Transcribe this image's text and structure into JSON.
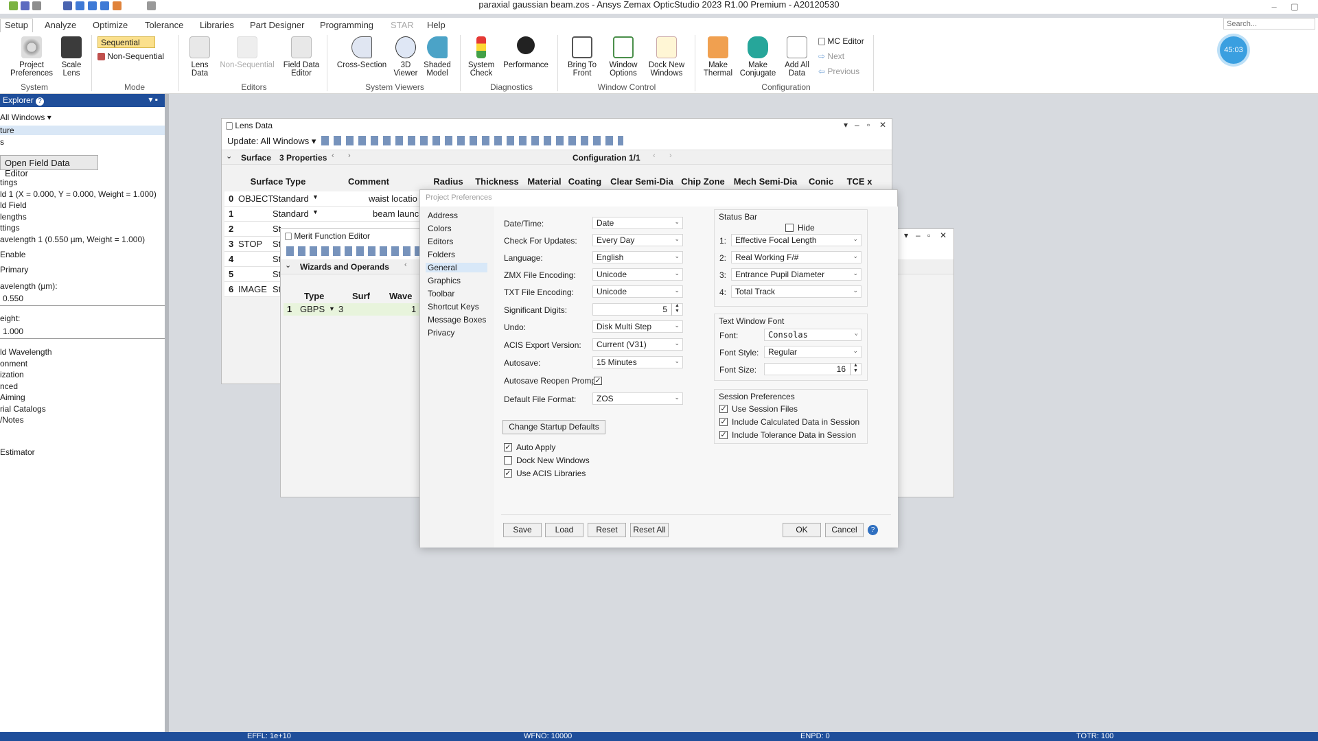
{
  "window": {
    "title": "paraxial gaussian beam.zos - Ansys Zemax OpticStudio 2023 R1.00   Premium - A20120530",
    "search_placeholder": "Search..."
  },
  "menu": {
    "tabs": [
      "Setup",
      "Analyze",
      "Optimize",
      "Tolerance",
      "Libraries",
      "Part Designer",
      "Programming",
      "STAR",
      "Help"
    ]
  },
  "ribbon": {
    "system": {
      "project_preferences": "Project Preferences",
      "scale_lens": "Scale Lens",
      "group": "System"
    },
    "mode": {
      "sequential": "Sequential",
      "non_sequential": "Non-Sequential",
      "group": "Mode"
    },
    "editors": {
      "lens_data": "Lens Data",
      "non_sequential": "Non-Sequential",
      "field_data_editor": "Field Data Editor",
      "group": "Editors"
    },
    "viewers": {
      "cross_section": "Cross-Section",
      "viewer_3d": "3D Viewer",
      "shaded_model": "Shaded Model",
      "group": "System Viewers"
    },
    "diagnostics": {
      "system_check": "System Check",
      "performance": "Performance",
      "group": "Diagnostics"
    },
    "window_control": {
      "bring_to_front": "Bring To Front",
      "window_options": "Window Options",
      "dock_new_windows": "Dock New Windows",
      "group": "Window Control"
    },
    "configuration": {
      "make_thermal": "Make Thermal",
      "make_conjugate": "Make Conjugate",
      "add_all_data": "Add All Data",
      "mc_editor": "MC Editor",
      "next": "Next",
      "previous": "Previous",
      "group": "Configuration"
    },
    "timer": "45:03"
  },
  "explorer": {
    "title": "Explorer",
    "update": "All Windows",
    "items": [
      "ture",
      "s",
      "tings",
      "ld 1 (X = 0.000, Y = 0.000, Weight = 1.000)",
      "ld Field",
      "lengths",
      "ttings",
      "avelength 1 (0.550 µm, Weight = 1.000)",
      "Enable",
      "Primary",
      "avelength (µm):",
      "eight:",
      "ld Wavelength",
      "onment",
      "ization",
      "nced",
      "Aiming",
      "rial Catalogs",
      "/Notes",
      "Estimator"
    ],
    "open_field_button": "Open Field Data Editor",
    "wavelength_value": "0.550",
    "weight_value": "1.000"
  },
  "lens_data": {
    "title": "Lens Data",
    "update": "Update: All Windows",
    "surface_label": "Surface",
    "properties": "3 Properties",
    "configuration": "Configuration 1/1",
    "columns": [
      "Surface Type",
      "Comment",
      "Radius",
      "Thickness",
      "Material",
      "Coating",
      "Clear Semi-Dia",
      "Chip Zone",
      "Mech Semi-Dia",
      "Conic",
      "TCE x"
    ],
    "rows": [
      {
        "num": "0",
        "label": "OBJECT",
        "type": "Standard",
        "comment": "waist locatio"
      },
      {
        "num": "1",
        "label": "",
        "type": "Standard",
        "comment": "beam launc"
      },
      {
        "num": "2",
        "label": "",
        "type": "St",
        "comment": ""
      },
      {
        "num": "3",
        "label": "STOP",
        "type": "St",
        "comment": ""
      },
      {
        "num": "4",
        "label": "",
        "type": "St",
        "comment": ""
      },
      {
        "num": "5",
        "label": "",
        "type": "St",
        "comment": ""
      },
      {
        "num": "6",
        "label": "IMAGE",
        "type": "St",
        "comment": ""
      }
    ]
  },
  "merit": {
    "title": "Merit Function Editor",
    "wizards": "Wizards and Operands",
    "columns": [
      "Type",
      "Surf",
      "Wave"
    ],
    "rows": [
      {
        "num": "1",
        "type": "GBPS",
        "surf": "3",
        "wave": "1"
      }
    ]
  },
  "dialog": {
    "title": "Project Preferences",
    "nav": [
      "Address",
      "Colors",
      "Editors",
      "Folders",
      "General",
      "Graphics",
      "Toolbar",
      "Shortcut Keys",
      "Message Boxes",
      "Privacy"
    ],
    "fields": {
      "datetime": {
        "label": "Date/Time:",
        "value": "Date"
      },
      "updates": {
        "label": "Check For Updates:",
        "value": "Every Day"
      },
      "language": {
        "label": "Language:",
        "value": "English"
      },
      "zmx": {
        "label": "ZMX File Encoding:",
        "value": "Unicode"
      },
      "txt": {
        "label": "TXT File Encoding:",
        "value": "Unicode"
      },
      "digits": {
        "label": "Significant Digits:",
        "value": "5"
      },
      "undo": {
        "label": "Undo:",
        "value": "Disk Multi Step"
      },
      "acis": {
        "label": "ACIS Export Version:",
        "value": "Current (V31)"
      },
      "autosave": {
        "label": "Autosave:",
        "value": "15 Minutes"
      },
      "reopen": {
        "label": "Autosave Reopen Prompt:"
      },
      "format": {
        "label": "Default File Format:",
        "value": "ZOS"
      }
    },
    "change_startup": "Change Startup Defaults",
    "checks": {
      "auto_apply": "Auto Apply",
      "dock_new": "Dock New Windows",
      "use_acis": "Use ACIS Libraries"
    },
    "status_bar": {
      "title": "Status Bar",
      "hide": "Hide",
      "items": [
        {
          "num": "1:",
          "value": "Effective Focal Length"
        },
        {
          "num": "2:",
          "value": "Real Working F/#"
        },
        {
          "num": "3:",
          "value": "Entrance Pupil Diameter"
        },
        {
          "num": "4:",
          "value": "Total Track"
        }
      ]
    },
    "font": {
      "title": "Text Window Font",
      "font_label": "Font:",
      "font_value": "Consolas",
      "style_label": "Font Style:",
      "style_value": "Regular",
      "size_label": "Font Size:",
      "size_value": "16"
    },
    "session": {
      "title": "Session Preferences",
      "use": "Use Session Files",
      "calc": "Include Calculated Data in Session",
      "tol": "Include Tolerance Data in Session"
    },
    "buttons": {
      "save": "Save",
      "load": "Load",
      "reset": "Reset",
      "reset_all": "Reset All",
      "ok": "OK",
      "cancel": "Cancel"
    }
  },
  "statusbar": {
    "effl": "EFFL: 1e+10",
    "wfno": "WFNO: 10000",
    "enpd": "ENPD: 0",
    "totr": "TOTR: 100"
  }
}
